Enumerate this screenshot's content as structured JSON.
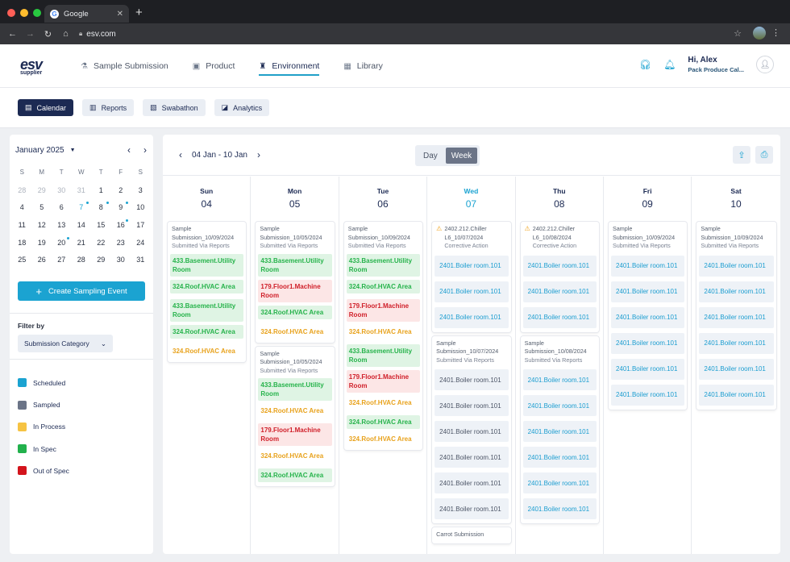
{
  "browser": {
    "tab_title": "Google",
    "url": "esv.com",
    "tab_close": "✕",
    "new_tab": "+"
  },
  "logo": {
    "line1": "esv",
    "line2": "supplier"
  },
  "nav": [
    {
      "label": "Sample Submission",
      "icon": "flask-icon"
    },
    {
      "label": "Product",
      "icon": "box-icon"
    },
    {
      "label": "Environment",
      "icon": "factory-icon"
    },
    {
      "label": "Library",
      "icon": "library-icon"
    }
  ],
  "user": {
    "greeting": "Hi, Alex",
    "company": "Pack Produce Cal..."
  },
  "subnav": [
    {
      "label": "Calendar",
      "icon": "calendar-icon"
    },
    {
      "label": "Reports",
      "icon": "reports-icon"
    },
    {
      "label": "Swabathon",
      "icon": "swab-icon"
    },
    {
      "label": "Analytics",
      "icon": "analytics-icon"
    }
  ],
  "minical": {
    "month": "January 2025",
    "dow": [
      "S",
      "M",
      "T",
      "W",
      "T",
      "F",
      "S"
    ],
    "weeks": [
      [
        "28",
        "29",
        "30",
        "31",
        "1",
        "2",
        "3"
      ],
      [
        "4",
        "5",
        "6",
        "7",
        "8",
        "9",
        "10"
      ],
      [
        "11",
        "12",
        "13",
        "14",
        "15",
        "16",
        "17"
      ],
      [
        "18",
        "19",
        "20",
        "21",
        "22",
        "23",
        "24"
      ],
      [
        "25",
        "26",
        "27",
        "28",
        "29",
        "30",
        "31"
      ]
    ]
  },
  "create_label": "Create Sampling Event",
  "filter": {
    "label": "Filter by",
    "select": "Submission Category"
  },
  "legend": [
    {
      "label": "Scheduled",
      "color": "#1ba3d1"
    },
    {
      "label": "Sampled",
      "color": "#6b7487"
    },
    {
      "label": "In Process",
      "color": "#f6c343"
    },
    {
      "label": "In Spec",
      "color": "#22b14c"
    },
    {
      "label": "Out of Spec",
      "color": "#d3141c"
    }
  ],
  "week": {
    "range": "04 Jan - 10 Jan",
    "day_label": "Day",
    "week_label": "Week"
  },
  "days": [
    {
      "dn": "Sun",
      "dd": "04",
      "cards": [
        {
          "h1": "Sample",
          "h2": "Submission_10/09/2024",
          "h3": "Submitted Via Reports",
          "events": [
            {
              "t": "433.Basement.Utility Room",
              "c": "green"
            },
            {
              "t": "324.Roof.HVAC Area",
              "c": "green"
            },
            {
              "t": "433.Basement.Utility Room",
              "c": "green",
              "sp": true
            },
            {
              "t": "324.Roof.HVAC Area",
              "c": "green"
            },
            {
              "t": "324.Roof.HVAC Area",
              "c": "orange",
              "sp": true
            }
          ]
        }
      ]
    },
    {
      "dn": "Mon",
      "dd": "05",
      "cards": [
        {
          "h1": "Sample",
          "h2": "Submission_10/05/2024",
          "h3": "Submitted Via Reports",
          "events": [
            {
              "t": "433.Basement.Utility Room",
              "c": "green"
            },
            {
              "t": "179.Floor1.Machine Room",
              "c": "red"
            },
            {
              "t": "324.Roof.HVAC Area",
              "c": "green"
            },
            {
              "t": "324.Roof.HVAC Area",
              "c": "orange",
              "sp": true
            }
          ]
        },
        {
          "h1": "Sample",
          "h2": "Submission_10/05/2024",
          "h3": "Submitted Via Reports",
          "events": [
            {
              "t": "433.Basement.Utility Room",
              "c": "green"
            },
            {
              "t": "324.Roof.HVAC Area",
              "c": "orange"
            },
            {
              "t": "179.Floor1.Machine Room",
              "c": "red",
              "sp": true
            },
            {
              "t": "324.Roof.HVAC Area",
              "c": "orange"
            },
            {
              "t": "324.Roof.HVAC Area",
              "c": "green",
              "sp": true
            }
          ]
        }
      ]
    },
    {
      "dn": "Tue",
      "dd": "06",
      "cards": [
        {
          "h1": "Sample",
          "h2": "Submission_10/09/2024",
          "h3": "Submitted Via Reports",
          "events": [
            {
              "t": "433.Basement.Utility Room",
              "c": "green"
            },
            {
              "t": "324.Roof.HVAC Area",
              "c": "green"
            },
            {
              "t": "179.Floor1.Machine Room",
              "c": "red",
              "sp": true
            },
            {
              "t": "324.Roof.HVAC Area",
              "c": "orange"
            },
            {
              "t": "433.Basement.Utility Room",
              "c": "green",
              "sp": true
            },
            {
              "t": "179.Floor1.Machine Room",
              "c": "red"
            },
            {
              "t": "324.Roof.HVAC Area",
              "c": "orange"
            },
            {
              "t": "324.Roof.HVAC Area",
              "c": "green",
              "sp": true
            },
            {
              "t": "324.Roof.HVAC Area",
              "c": "orange"
            }
          ]
        }
      ]
    },
    {
      "dn": "Wed",
      "dd": "07",
      "today": true,
      "cards": [
        {
          "warn": true,
          "h1": "2402.212.Chiller L6_10/07/2024",
          "h3": "Corrective Action",
          "events": [
            {
              "t": "2401.Boiler room.101",
              "c": "blue"
            },
            {
              "t": "2401.Boiler room.101",
              "c": "blue"
            },
            {
              "t": "2401.Boiler room.101",
              "c": "blue"
            }
          ]
        },
        {
          "h1": "Sample",
          "h2": "Submission_10/07/2024",
          "h3": "Submitted Via Reports",
          "events": [
            {
              "t": "2401.Boiler room.101",
              "c": "gray"
            },
            {
              "t": "2401.Boiler room.101",
              "c": "gray"
            },
            {
              "t": "2401.Boiler room.101",
              "c": "gray"
            },
            {
              "t": "2401.Boiler room.101",
              "c": "gray"
            },
            {
              "t": "2401.Boiler room.101",
              "c": "gray"
            },
            {
              "t": "2401.Boiler room.101",
              "c": "gray"
            }
          ]
        },
        {
          "h1": "Carrot Submission",
          "events": []
        }
      ]
    },
    {
      "dn": "Thu",
      "dd": "08",
      "cards": [
        {
          "warn": true,
          "h1": "2402.212.Chiller L6_10/08/2024",
          "h3": "Corrective Action",
          "events": [
            {
              "t": "2401.Boiler room.101",
              "c": "blue"
            },
            {
              "t": "2401.Boiler room.101",
              "c": "blue"
            },
            {
              "t": "2401.Boiler room.101",
              "c": "blue"
            }
          ]
        },
        {
          "h1": "Sample",
          "h2": "Submission_10/08/2024",
          "h3": "Submitted Via Reports",
          "events": [
            {
              "t": "2401.Boiler room.101",
              "c": "blue"
            },
            {
              "t": "2401.Boiler room.101",
              "c": "blue"
            },
            {
              "t": "2401.Boiler room.101",
              "c": "blue"
            },
            {
              "t": "2401.Boiler room.101",
              "c": "blue"
            },
            {
              "t": "2401.Boiler room.101",
              "c": "blue"
            },
            {
              "t": "2401.Boiler room.101",
              "c": "blue"
            }
          ]
        }
      ]
    },
    {
      "dn": "Fri",
      "dd": "09",
      "cards": [
        {
          "h1": "Sample",
          "h2": "Submission_10/09/2024",
          "h3": "Submitted Via Reports",
          "events": [
            {
              "t": "2401.Boiler room.101",
              "c": "blue"
            },
            {
              "t": "2401.Boiler room.101",
              "c": "blue"
            },
            {
              "t": "2401.Boiler room.101",
              "c": "blue"
            },
            {
              "t": "2401.Boiler room.101",
              "c": "blue"
            },
            {
              "t": "2401.Boiler room.101",
              "c": "blue"
            },
            {
              "t": "2401.Boiler room.101",
              "c": "blue"
            }
          ]
        }
      ]
    },
    {
      "dn": "Sat",
      "dd": "10",
      "cards": [
        {
          "h1": "Sample",
          "h2": "Submission_10/09/2024",
          "h3": "Submitted Via Reports",
          "events": [
            {
              "t": "2401.Boiler room.101",
              "c": "blue"
            },
            {
              "t": "2401.Boiler room.101",
              "c": "blue"
            },
            {
              "t": "2401.Boiler room.101",
              "c": "blue"
            },
            {
              "t": "2401.Boiler room.101",
              "c": "blue"
            },
            {
              "t": "2401.Boiler room.101",
              "c": "blue"
            },
            {
              "t": "2401.Boiler room.101",
              "c": "blue"
            }
          ]
        }
      ]
    }
  ]
}
